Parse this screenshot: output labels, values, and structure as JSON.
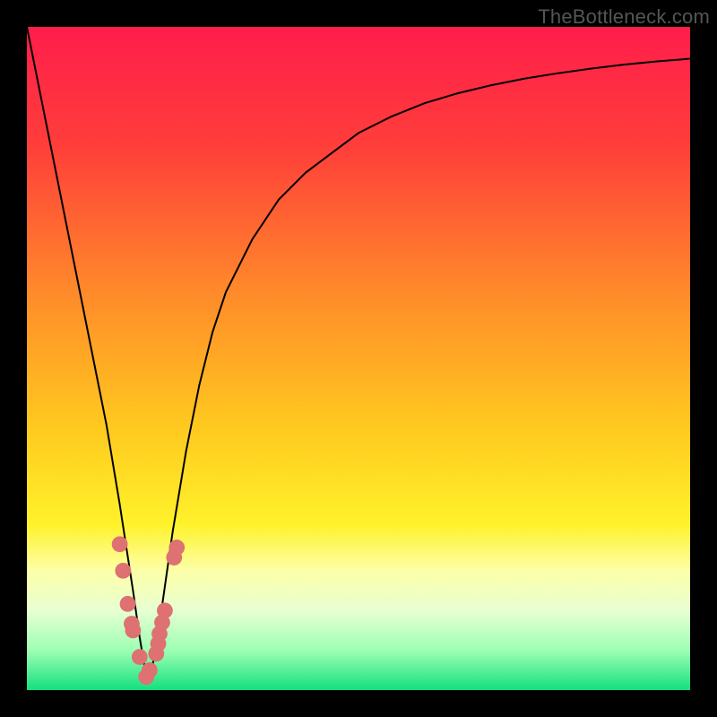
{
  "watermark": "TheBottleneck.com",
  "chart_data": {
    "type": "line",
    "title": "",
    "xlabel": "",
    "ylabel": "",
    "xlim": [
      0,
      100
    ],
    "ylim": [
      0,
      100
    ],
    "grid": false,
    "gradient_stops": [
      {
        "offset": 0,
        "color": "#ff1d4b"
      },
      {
        "offset": 18,
        "color": "#ff3e3a"
      },
      {
        "offset": 40,
        "color": "#ff8a2a"
      },
      {
        "offset": 60,
        "color": "#ffc81f"
      },
      {
        "offset": 75,
        "color": "#fff22a"
      },
      {
        "offset": 82,
        "color": "#fdffa8"
      },
      {
        "offset": 88,
        "color": "#e8ffd2"
      },
      {
        "offset": 94,
        "color": "#9dffb4"
      },
      {
        "offset": 100,
        "color": "#13e07e"
      }
    ],
    "series": [
      {
        "name": "bottleneck-curve",
        "x": [
          0,
          2,
          4,
          6,
          8,
          10,
          12,
          14,
          16,
          17,
          18,
          19,
          20,
          22,
          24,
          26,
          28,
          30,
          34,
          38,
          42,
          46,
          50,
          55,
          60,
          65,
          70,
          75,
          80,
          85,
          90,
          95,
          100
        ],
        "y": [
          100,
          90,
          80,
          70,
          60,
          50,
          40,
          28,
          15,
          8,
          2,
          4,
          10,
          24,
          36,
          46,
          54,
          60,
          68,
          74,
          78,
          81,
          84,
          86.5,
          88.5,
          90,
          91.2,
          92.2,
          93,
          93.7,
          94.3,
          94.8,
          95.2
        ]
      }
    ],
    "markers": {
      "color": "#de7171",
      "radius_frac": 0.012,
      "points_xy": [
        [
          14.0,
          22.0
        ],
        [
          14.5,
          18.0
        ],
        [
          15.2,
          13.0
        ],
        [
          15.8,
          10.0
        ],
        [
          16.0,
          9.0
        ],
        [
          17.0,
          5.0
        ],
        [
          18.0,
          2.0
        ],
        [
          18.5,
          3.0
        ],
        [
          19.5,
          5.5
        ],
        [
          19.8,
          7.0
        ],
        [
          20.0,
          8.5
        ],
        [
          20.4,
          10.2
        ],
        [
          20.8,
          12.0
        ],
        [
          22.2,
          20.0
        ],
        [
          22.6,
          21.5
        ]
      ]
    }
  }
}
